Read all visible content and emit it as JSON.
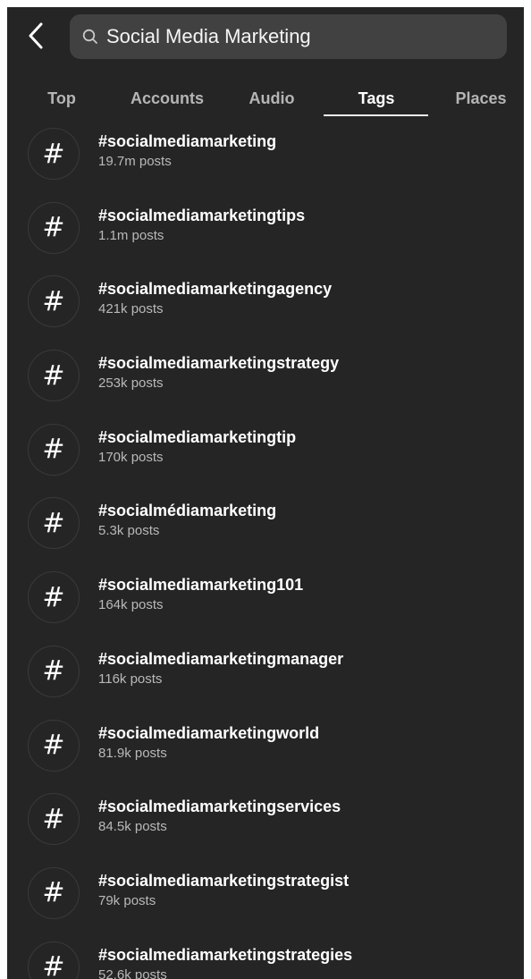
{
  "search": {
    "query": "Social Media Marketing"
  },
  "tabs": [
    {
      "label": "Top",
      "active": false
    },
    {
      "label": "Accounts",
      "active": false
    },
    {
      "label": "Audio",
      "active": false
    },
    {
      "label": "Tags",
      "active": true
    },
    {
      "label": "Places",
      "active": false
    }
  ],
  "results": [
    {
      "icon": "hashtag-icon",
      "symbol": "#",
      "name": "#socialmediamarketing",
      "count": "19.7m posts"
    },
    {
      "icon": "hashtag-icon",
      "symbol": "#",
      "name": "#socialmediamarketingtips",
      "count": "1.1m posts"
    },
    {
      "icon": "hashtag-icon",
      "symbol": "#",
      "name": "#socialmediamarketingagency",
      "count": "421k posts"
    },
    {
      "icon": "hashtag-icon",
      "symbol": "#",
      "name": "#socialmediamarketingstrategy",
      "count": "253k posts"
    },
    {
      "icon": "hashtag-icon",
      "symbol": "#",
      "name": "#socialmediamarketingtip",
      "count": "170k posts"
    },
    {
      "icon": "hashtag-icon",
      "symbol": "#",
      "name": "#socialmédiamarketing",
      "count": "5.3k posts"
    },
    {
      "icon": "hashtag-icon",
      "symbol": "#",
      "name": "#socialmediamarketing101",
      "count": "164k posts"
    },
    {
      "icon": "hashtag-icon",
      "symbol": "#",
      "name": "#socialmediamarketingmanager",
      "count": "116k posts"
    },
    {
      "icon": "hashtag-icon",
      "symbol": "#",
      "name": "#socialmediamarketingworld",
      "count": "81.9k posts"
    },
    {
      "icon": "hashtag-icon",
      "symbol": "#",
      "name": "#socialmediamarketingservices",
      "count": "84.5k posts"
    },
    {
      "icon": "hashtag-icon",
      "symbol": "#",
      "name": "#socialmediamarketingstrategist",
      "count": "79k posts"
    },
    {
      "icon": "hashtag-icon",
      "symbol": "#",
      "name": "#socialmediamarketingstrategies",
      "count": "52.6k posts"
    }
  ],
  "colors": {
    "background": "#252525",
    "search_background": "#414141",
    "text_primary": "#ffffff",
    "text_secondary": "#b9b9b9",
    "tab_inactive": "#b5b5b5"
  }
}
